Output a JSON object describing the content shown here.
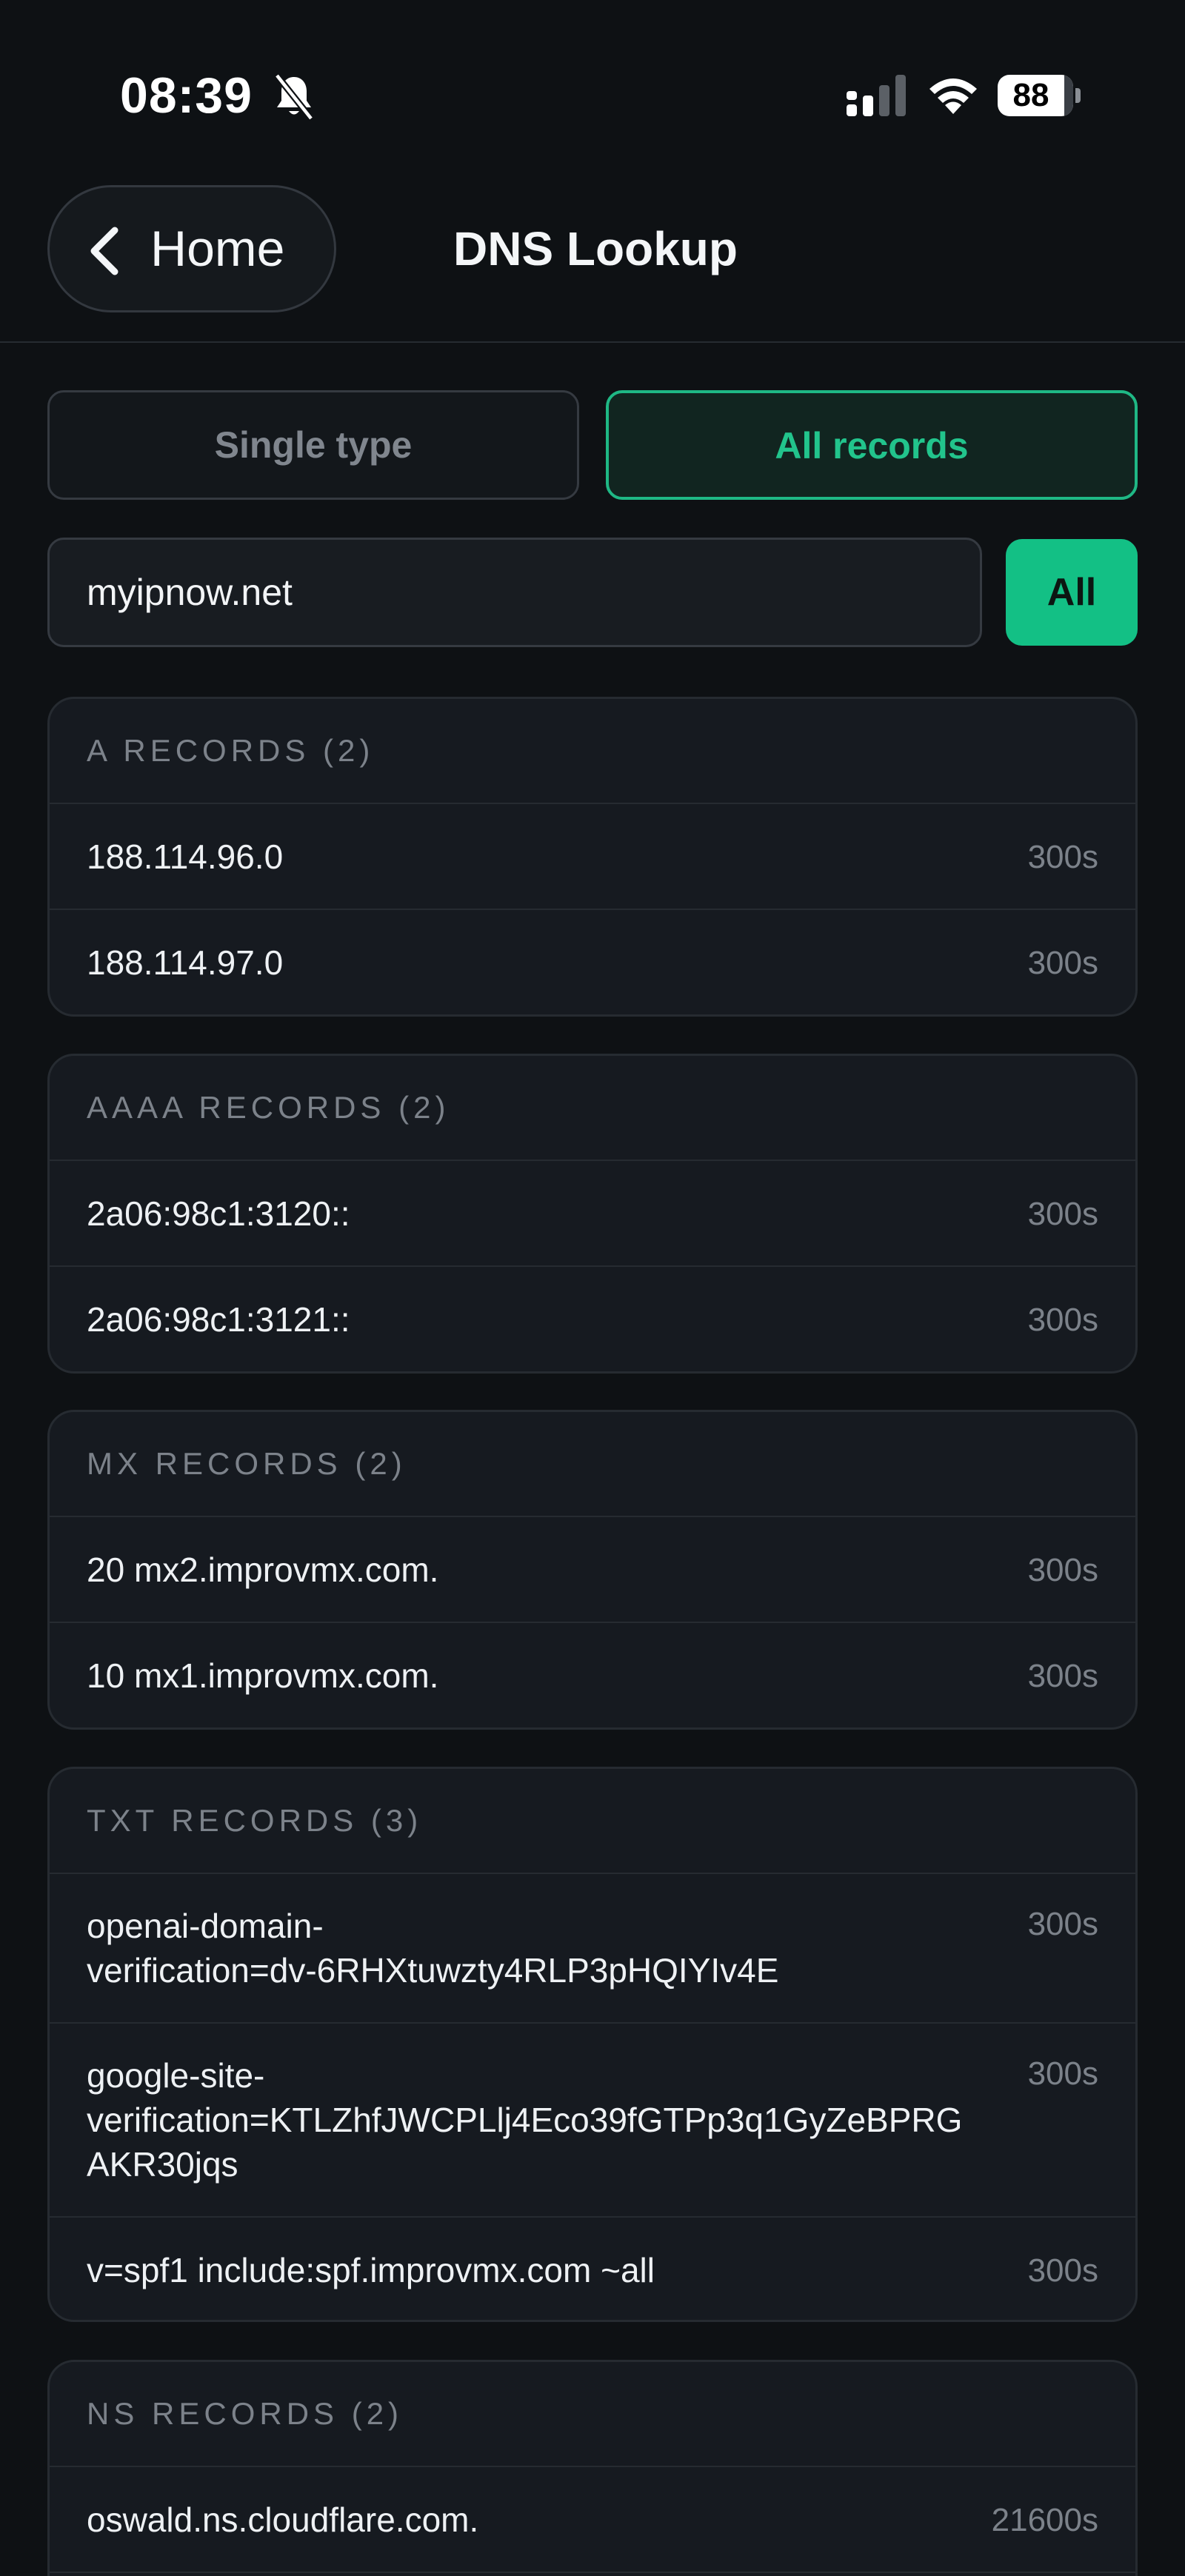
{
  "status": {
    "time": "08:39",
    "battery": 88
  },
  "nav": {
    "back_label": "Home",
    "title": "DNS Lookup"
  },
  "mode": {
    "single_label": "Single type",
    "all_label": "All records"
  },
  "search": {
    "domain": "myipnow.net",
    "button_label": "All"
  },
  "colors": {
    "accent": "#13c085",
    "background": "#0e1114",
    "card": "#161a20"
  },
  "records": {
    "a": {
      "header": "A RECORDS (2)",
      "rows": [
        {
          "value": "188.114.96.0",
          "ttl": "300s"
        },
        {
          "value": "188.114.97.0",
          "ttl": "300s"
        }
      ]
    },
    "aaaa": {
      "header": "AAAA RECORDS (2)",
      "rows": [
        {
          "value": "2a06:98c1:3120::",
          "ttl": "300s"
        },
        {
          "value": "2a06:98c1:3121::",
          "ttl": "300s"
        }
      ]
    },
    "mx": {
      "header": "MX RECORDS (2)",
      "rows": [
        {
          "value": "20 mx2.improvmx.com.",
          "ttl": "300s"
        },
        {
          "value": "10 mx1.improvmx.com.",
          "ttl": "300s"
        }
      ]
    },
    "txt": {
      "header": "TXT RECORDS (3)",
      "rows": [
        {
          "lines": [
            "openai-domain-",
            "verification=dv-6RHXtuwzty4RLP3pHQIYIv4E"
          ],
          "ttl": "300s"
        },
        {
          "lines": [
            "google-site-",
            "verification=KTLZhfJWCPLlj4Eco39fGTPp3q1GyZeBPRG",
            "AKR30jqs"
          ],
          "ttl": "300s"
        },
        {
          "value": "v=spf1 include:spf.improvmx.com ~all",
          "ttl": "300s"
        }
      ]
    },
    "ns": {
      "header": "NS RECORDS (2)",
      "rows": [
        {
          "value": "oswald.ns.cloudflare.com.",
          "ttl": "21600s"
        }
      ]
    }
  }
}
